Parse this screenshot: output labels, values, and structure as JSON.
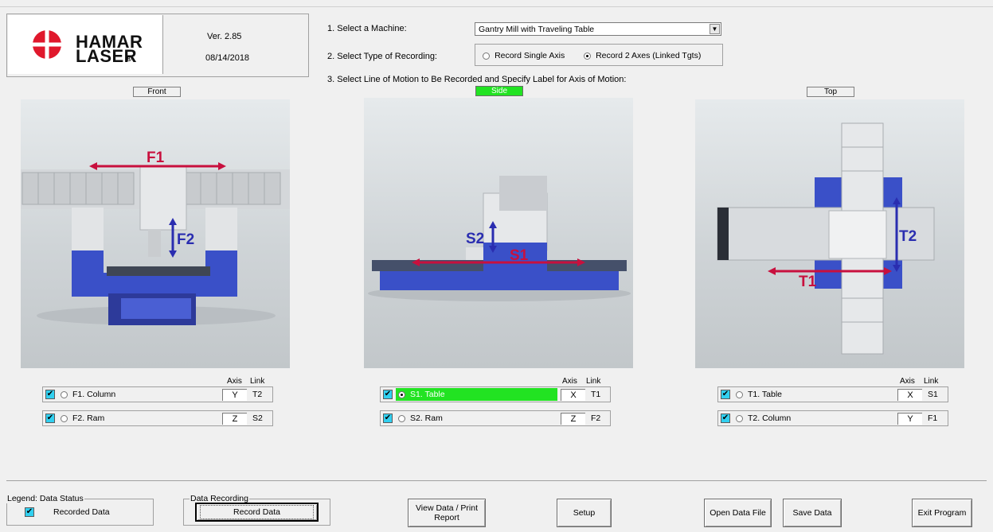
{
  "brand": {
    "line1": "HAMAR",
    "line2": "LASER",
    "registered": "®"
  },
  "version": "Ver. 2.85",
  "date": "08/14/2018",
  "step1": {
    "label": "1. Select a Machine:",
    "selected": "Gantry Mill with Traveling Table"
  },
  "step2": {
    "label": "2. Select Type of Recording:",
    "options": [
      "Record Single Axis",
      "Record 2 Axes (Linked Tgts)"
    ],
    "selected_index": 1
  },
  "step3": {
    "label": "3. Select Line of Motion to Be Recorded and Specify Label for Axis of Motion:"
  },
  "views": {
    "front": {
      "tag": "Front",
      "active": false,
      "arrow_labels": [
        "F1",
        "F2"
      ],
      "header_axis": "Axis",
      "header_link": "Link",
      "rows": [
        {
          "label": "F1. Column",
          "checked": true,
          "selected": false,
          "axis": "Y",
          "link": "T2"
        },
        {
          "label": "F2. Ram",
          "checked": true,
          "selected": false,
          "axis": "Z",
          "link": "S2"
        }
      ]
    },
    "side": {
      "tag": "Side",
      "active": true,
      "arrow_labels": [
        "S2",
        "S1"
      ],
      "header_axis": "Axis",
      "header_link": "Link",
      "rows": [
        {
          "label": "S1. Table",
          "checked": true,
          "selected": true,
          "axis": "X",
          "link": "T1"
        },
        {
          "label": "S2. Ram",
          "checked": true,
          "selected": false,
          "axis": "Z",
          "link": "F2"
        }
      ]
    },
    "top": {
      "tag": "Top",
      "active": false,
      "arrow_labels": [
        "T2",
        "T1"
      ],
      "header_axis": "Axis",
      "header_link": "Link",
      "rows": [
        {
          "label": "T1. Table",
          "checked": true,
          "selected": false,
          "axis": "X",
          "link": "S1"
        },
        {
          "label": "T2. Column",
          "checked": true,
          "selected": false,
          "axis": "Y",
          "link": "F1"
        }
      ]
    }
  },
  "legend": {
    "title": "Legend: Data Status",
    "item": "Recorded Data"
  },
  "data_recording": {
    "title": "Data Recording",
    "button": "Record Data"
  },
  "buttons": {
    "view_data_line1": "View Data / Print",
    "view_data_line2": "Report",
    "setup": "Setup",
    "open": "Open Data File",
    "save": "Save Data",
    "exit": "Exit Program"
  },
  "colors": {
    "arrow_red": "#c8103e",
    "arrow_blue": "#2a2db0",
    "machine_blue": "#3a50c8",
    "active_green": "#22e322",
    "check_cyan": "#31d0f0"
  }
}
